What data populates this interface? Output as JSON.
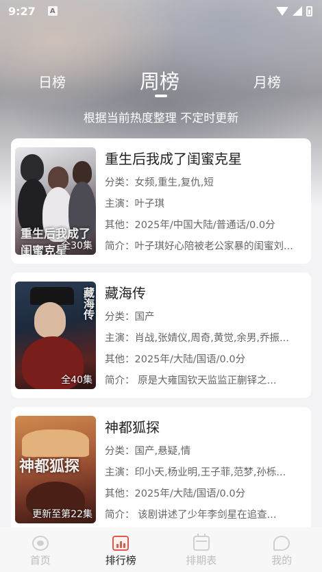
{
  "status_bar": {
    "time": "9:27",
    "indicator": "A",
    "icons": [
      "wifi-icon",
      "signal-icon",
      "battery-icon"
    ]
  },
  "tabs": {
    "day": "日榜",
    "week": "周榜",
    "month": "月榜",
    "active": "week"
  },
  "subtitle": "根据当前热度整理 不定时更新",
  "items": [
    {
      "title": "重生后我成了闺蜜克星",
      "category": "分类：女频,重生,复仇,短",
      "cast": "主演：叶子琪",
      "other": "其他：2025年/中国大陆/普通话/0.0分",
      "summary": "简介：叶子琪好心陪被老公家暴的闺蜜刘...",
      "badge": "全30集",
      "poster_art": "重生后我成了闺蜜克星"
    },
    {
      "title": "藏海传",
      "category": "分类：国产",
      "cast": "主演：肖战,张婧仪,周奇,黄觉,余男,乔振...",
      "other": "其他：2025年/大陆/国语/0.0分",
      "summary": "简介：        原是大雍国钦天监监正蒯铎之...",
      "badge": "全40集",
      "poster_art": "藏海传"
    },
    {
      "title": "神都狐探",
      "category": "分类：国产,悬疑,情",
      "cast": "主演：印小天,杨业明,王子菲,范梦,孙栎...",
      "other": "其他：2025年/大陆/国语/0.0分",
      "summary": "简介：        该剧讲述了少年李剑星在追查...",
      "badge": "更新至第22集",
      "poster_art": "神都狐探"
    }
  ],
  "bottom_nav": [
    {
      "label": "首页",
      "icon": "home-icon"
    },
    {
      "label": "排行榜",
      "icon": "ranking-icon",
      "active": true
    },
    {
      "label": "排期表",
      "icon": "calendar-icon"
    },
    {
      "label": "我的",
      "icon": "profile-icon"
    }
  ],
  "colors": {
    "accent": "#e0584a",
    "text_primary": "#222222",
    "text_secondary": "#666666",
    "nav_inactive": "#bdbdbf"
  }
}
